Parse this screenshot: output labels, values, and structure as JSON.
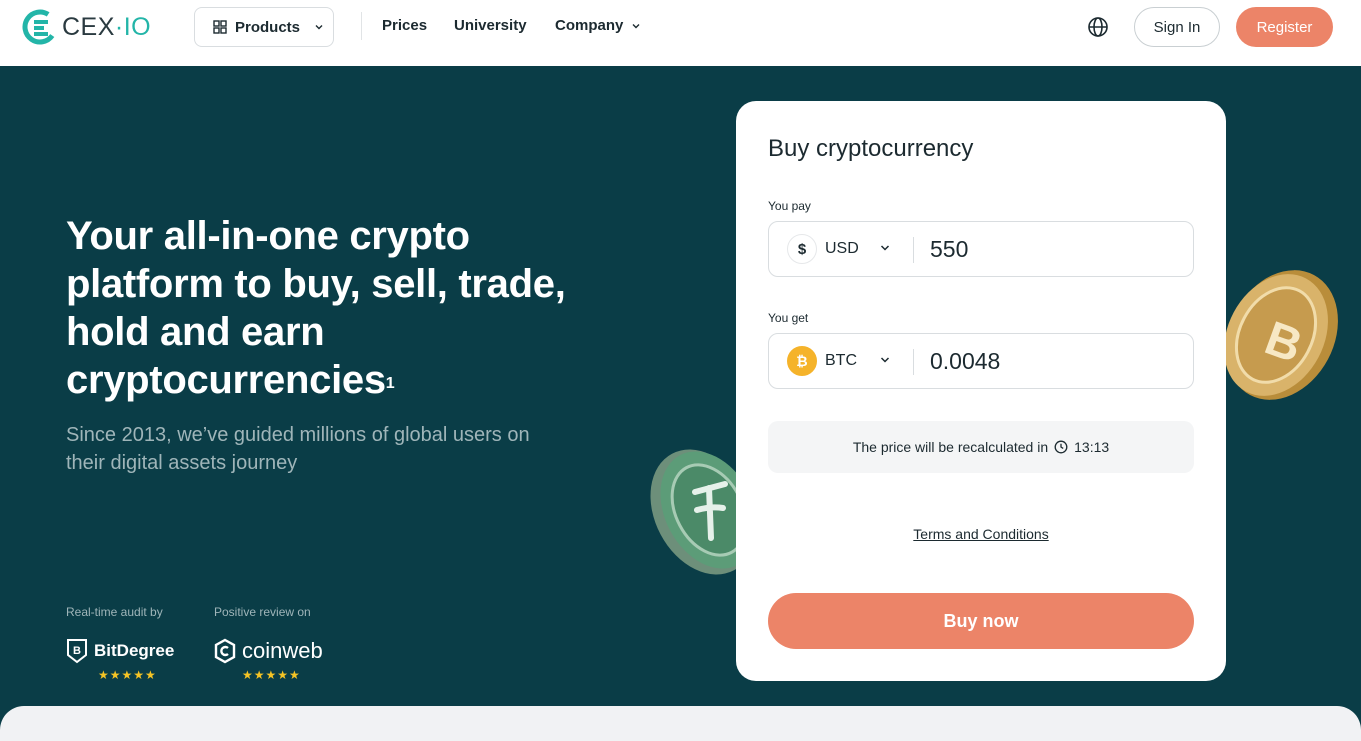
{
  "header": {
    "logo_text": "CEX",
    "logo_dot": "·",
    "logo_suffix": "IO",
    "products_label": "Products",
    "nav": [
      {
        "label": "Prices"
      },
      {
        "label": "University"
      },
      {
        "label": "Company"
      }
    ],
    "signin_label": "Sign In",
    "register_label": "Register"
  },
  "hero": {
    "title": "Your all-in-one crypto platform to buy, sell, trade, hold and earn cryptocurrencies",
    "title_sup": "1",
    "subtitle": "Since 2013, we’ve guided millions of global users on their digital assets journey",
    "audit_label": "Real-time audit by",
    "audit_brand": "BitDegree",
    "review_label": "Positive review on",
    "review_brand": "coinweb",
    "audit_rating": "★★★★★",
    "review_rating": "★★★★★"
  },
  "card": {
    "title": "Buy cryptocurrency",
    "pay_label": "You pay",
    "pay_currency_icon": "$",
    "pay_currency": "USD",
    "pay_amount": "550",
    "get_label": "You get",
    "get_currency_icon": "₿",
    "get_currency": "BTC",
    "get_amount": "0.0048",
    "recalc_text": "The price will be recalculated in",
    "recalc_timer": "13:13",
    "terms": "Terms and Conditions",
    "buy_label": "Buy now"
  },
  "colors": {
    "accent": "#ec8468",
    "hero_bg": "#0a3d47",
    "brand_teal": "#23b5a8"
  }
}
